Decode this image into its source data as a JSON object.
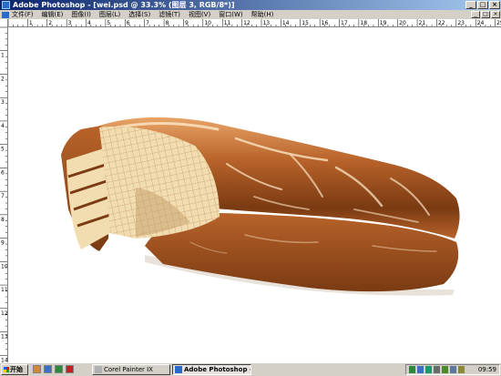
{
  "window": {
    "title": "Adobe Photoshop - [wei.psd @ 33.3% (图层 3, RGB/8*)]",
    "controls": {
      "minimize": "_",
      "maximize": "□",
      "close": "×"
    }
  },
  "menubar": {
    "items": [
      {
        "key": "file",
        "label": "文件(F)"
      },
      {
        "key": "edit",
        "label": "编辑(E)"
      },
      {
        "key": "image",
        "label": "图像(I)"
      },
      {
        "key": "layer",
        "label": "图层(L)"
      },
      {
        "key": "select",
        "label": "选择(S)"
      },
      {
        "key": "filter",
        "label": "滤镜(T)"
      },
      {
        "key": "view",
        "label": "视图(V)"
      },
      {
        "key": "window",
        "label": "窗口(W)"
      },
      {
        "key": "help",
        "label": "帮助(H)"
      }
    ]
  },
  "rulers": {
    "top_labels": [
      "1",
      "2",
      "3",
      "4",
      "5",
      "6",
      "7",
      "8",
      "9",
      "10",
      "11",
      "12",
      "13",
      "14",
      "15",
      "16",
      "17",
      "18",
      "19",
      "20",
      "21",
      "22",
      "23",
      "24",
      "25"
    ],
    "left_labels": [
      "1",
      "2",
      "3",
      "4",
      "5",
      "6",
      "7",
      "8",
      "9",
      "10",
      "11",
      "12",
      "13",
      "14"
    ]
  },
  "canvas": {
    "colors": {
      "background": "#ffffff",
      "chocolate_dark": "#7a3a12",
      "chocolate_mid": "#b8632a",
      "chocolate_light": "#e8a468",
      "highlight": "#fbe3c2",
      "wafer": "#f2ddb0",
      "wafer_shadow": "#c9a070"
    }
  },
  "taskbar": {
    "start_label": "开始",
    "quick_launch": [
      {
        "name": "show-desktop-icon",
        "color": "#d08a30"
      },
      {
        "name": "ie-icon",
        "color": "#3a6fc8"
      },
      {
        "name": "ps-quick-icon",
        "color": "#2a8a3a"
      },
      {
        "name": "media-icon",
        "color": "#c02020"
      }
    ],
    "tasks": [
      {
        "label": "Corel Painter IX",
        "active": false,
        "icon_color": "#b0b0b0"
      },
      {
        "label": "Adobe Photoshop - [w...",
        "active": true,
        "icon_color": "#2a6ac8"
      }
    ],
    "clock": "09:59"
  }
}
